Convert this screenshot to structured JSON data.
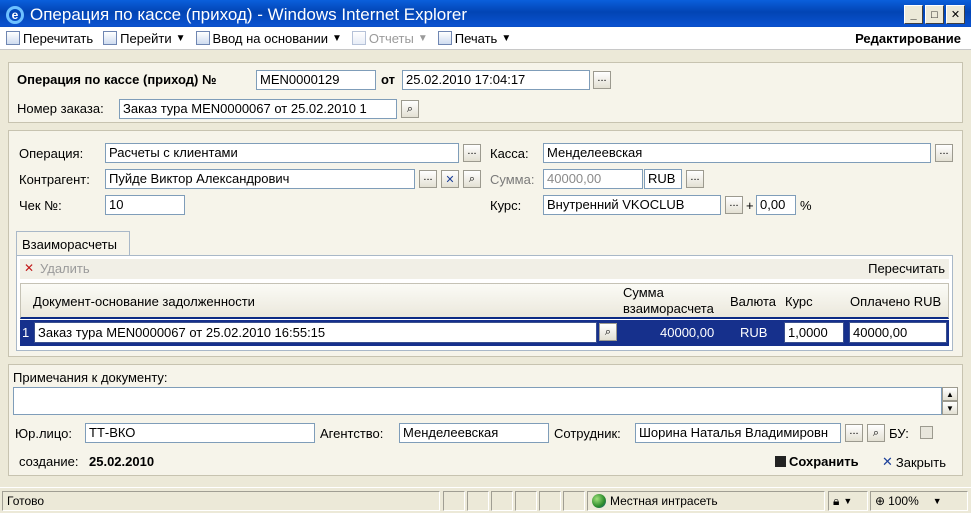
{
  "window": {
    "title": "Операция по кассе (приход) - Windows Internet Explorer"
  },
  "toolbar": {
    "reread": "Перечитать",
    "goto": "Перейти",
    "based_on": "Ввод на основании",
    "reports": "Отчеты",
    "print": "Печать",
    "mode": "Редактирование"
  },
  "header": {
    "doc_label": "Операция по кассе (приход) №",
    "doc_number": "MEN0000129",
    "from_label": "от",
    "date": "25.02.2010 17:04:17",
    "order_label": "Номер заказа:",
    "order_value": "Заказ тура MEN0000067 от 25.02.2010 1"
  },
  "main": {
    "operation_label": "Операция:",
    "operation_value": "Расчеты с клиентами",
    "counterparty_label": "Контрагент:",
    "counterparty_value": "Пуйде Виктор Александрович",
    "check_label": "Чек №:",
    "check_value": "10",
    "cashbox_label": "Касса:",
    "cashbox_value": "Менделеевская",
    "sum_label": "Сумма:",
    "sum_value": "40000,00",
    "currency": "RUB",
    "rate_label": "Курс:",
    "rate_value": "Внутренний VKOCLUB",
    "plus": "+",
    "percent_value": "0,00",
    "percent_sign": "%"
  },
  "tabs": [
    {
      "label": "Взаиморасчеты"
    }
  ],
  "grid": {
    "delete_label": "Удалить",
    "recalc_label": "Пересчитать",
    "columns": {
      "doc": "Документ-основание задолженности",
      "sum": "Сумма взаиморасчета",
      "currency": "Валюта",
      "rate": "Курс",
      "paid": "Оплачено RUB"
    },
    "rows": [
      {
        "n": "1",
        "doc": "Заказ тура MEN0000067 от 25.02.2010 16:55:15",
        "sum": "40000,00",
        "currency": "RUB",
        "rate": "1,0000",
        "paid": "40000,00"
      }
    ]
  },
  "footer": {
    "notes_label": "Примечания к документу:",
    "legal_label": "Юр.лицо:",
    "legal_value": "ТТ-ВКО",
    "agency_label": "Агентство:",
    "agency_value": "Менделеевская",
    "employee_label": "Сотрудник:",
    "employee_value": "Шорина Наталья Владимировн",
    "bu_label": "БУ:",
    "created_label": "создание:",
    "created_value": "25.02.2010",
    "save_label": "Сохранить",
    "close_label": "Закрыть"
  },
  "status": {
    "text": "Готово",
    "zone": "Местная интрасеть",
    "zoom": "100%"
  }
}
